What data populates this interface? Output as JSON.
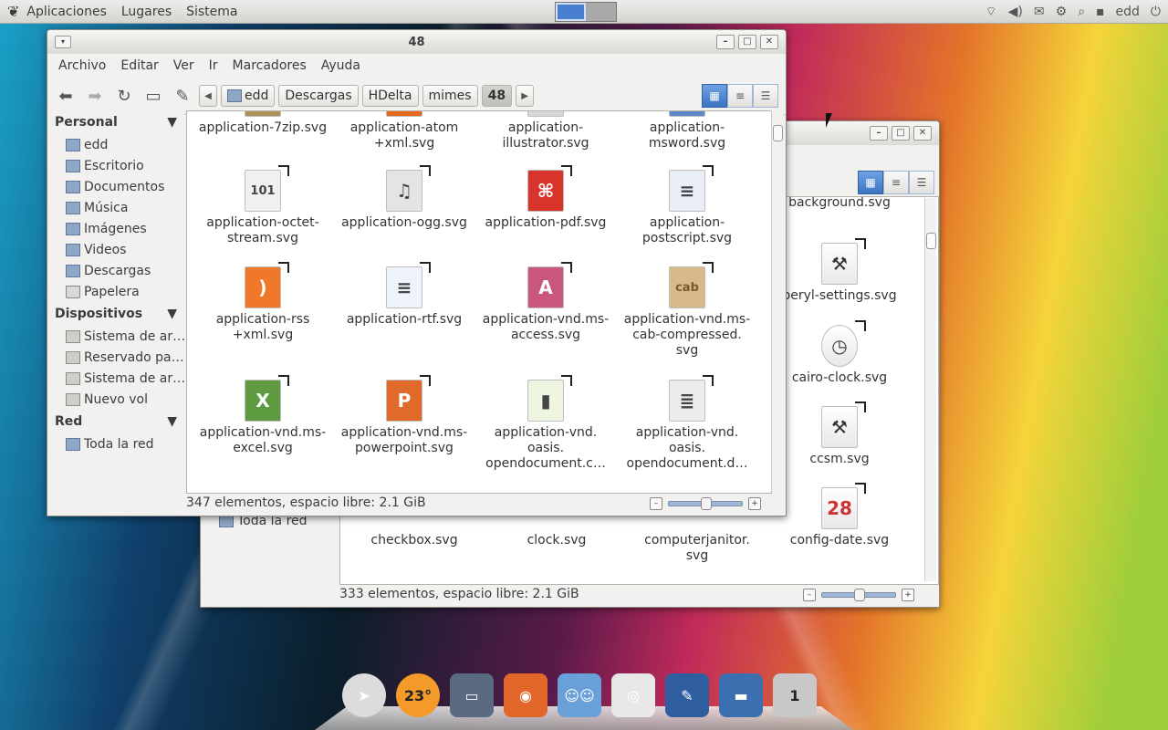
{
  "top_panel": {
    "menus": [
      "Aplicaciones",
      "Lugares",
      "Sistema"
    ],
    "user": "edd"
  },
  "front_window": {
    "title": "48",
    "menubar": [
      "Archivo",
      "Editar",
      "Ver",
      "Ir",
      "Marcadores",
      "Ayuda"
    ],
    "breadcrumbs": [
      "edd",
      "Descargas",
      "HDelta",
      "mimes",
      "48"
    ],
    "sidebar": {
      "personal": {
        "header": "Personal",
        "items": [
          "edd",
          "Escritorio",
          "Documentos",
          "Música",
          "Imágenes",
          "Videos",
          "Descargas",
          "Papelera"
        ]
      },
      "devices": {
        "header": "Dispositivos",
        "items": [
          "Sistema de ar…",
          "Reservado pa…",
          "Sistema de ar…",
          "Nuevo vol"
        ]
      },
      "network": {
        "header": "Red",
        "items": [
          "Toda la red"
        ]
      }
    },
    "files": [
      {
        "name": "application-7zip.svg",
        "icon": "7zip-archive-icon"
      },
      {
        "name": "application-atom\n+xml.svg",
        "icon": "atom-feed-icon"
      },
      {
        "name": "application-\nillustrator.svg",
        "icon": "illustrator-icon"
      },
      {
        "name": "application-\nmsword.svg",
        "icon": "msword-icon"
      },
      {
        "name": "application-octet-\nstream.svg",
        "icon": "binary-file-icon",
        "glyph": "101"
      },
      {
        "name": "application-ogg.svg",
        "icon": "ogg-audio-icon",
        "glyph": "♫"
      },
      {
        "name": "application-pdf.svg",
        "icon": "pdf-icon",
        "glyph": "⌘"
      },
      {
        "name": "application-\npostscript.svg",
        "icon": "postscript-icon",
        "glyph": "≡"
      },
      {
        "name": "application-rss\n+xml.svg",
        "icon": "rss-feed-icon",
        "glyph": ")"
      },
      {
        "name": "application-rtf.svg",
        "icon": "rtf-document-icon",
        "glyph": "≡"
      },
      {
        "name": "application-vnd.ms-\naccess.svg",
        "icon": "ms-access-icon",
        "glyph": "A"
      },
      {
        "name": "application-vnd.ms-\ncab-compressed.\nsvg",
        "icon": "cab-archive-icon",
        "glyph": "cab"
      },
      {
        "name": "application-vnd.ms-\nexcel.svg",
        "icon": "ms-excel-icon",
        "glyph": "X"
      },
      {
        "name": "application-vnd.ms-\npowerpoint.svg",
        "icon": "ms-powerpoint-icon",
        "glyph": "P"
      },
      {
        "name": "application-vnd.\noasis.\nopendocument.c…",
        "icon": "opendocument-chart-icon",
        "glyph": "▮"
      },
      {
        "name": "application-vnd.\noasis.\nopendocument.d…",
        "icon": "opendocument-database-icon",
        "glyph": "≣"
      }
    ],
    "status": "347 elementos, espacio libre: 2.1 GiB",
    "zoom_fraction": 0.5
  },
  "back_window": {
    "sidebar_visible_item": "Toda la red",
    "files_right": [
      {
        "name": "background.svg",
        "icon": "background-icon"
      },
      {
        "name": "beryl-settings.svg",
        "icon": "settings-tools-icon",
        "glyph": "⚒"
      },
      {
        "name": "cairo-clock.svg",
        "icon": "clock-icon",
        "glyph": "◷"
      },
      {
        "name": "ccsm.svg",
        "icon": "settings-tools-icon",
        "glyph": "⚒"
      },
      {
        "name": "config-date.svg",
        "icon": "calendar-icon",
        "glyph": "28"
      }
    ],
    "files_bottom": [
      "checkbox.svg",
      "clock.svg",
      "computerjanitor.\nsvg"
    ],
    "status": "333 elementos, espacio libre: 2.1 GiB",
    "zoom_fraction": 0.5
  },
  "dock": {
    "items": [
      {
        "icon": "compass-icon"
      },
      {
        "icon": "weather-icon",
        "label": "23°"
      },
      {
        "icon": "monitor-icon"
      },
      {
        "icon": "firefox-icon"
      },
      {
        "icon": "contacts-icon"
      },
      {
        "icon": "speaker-icon"
      },
      {
        "icon": "writer-icon"
      },
      {
        "icon": "screen-icon"
      },
      {
        "icon": "trash-icon",
        "label": "1"
      }
    ]
  }
}
